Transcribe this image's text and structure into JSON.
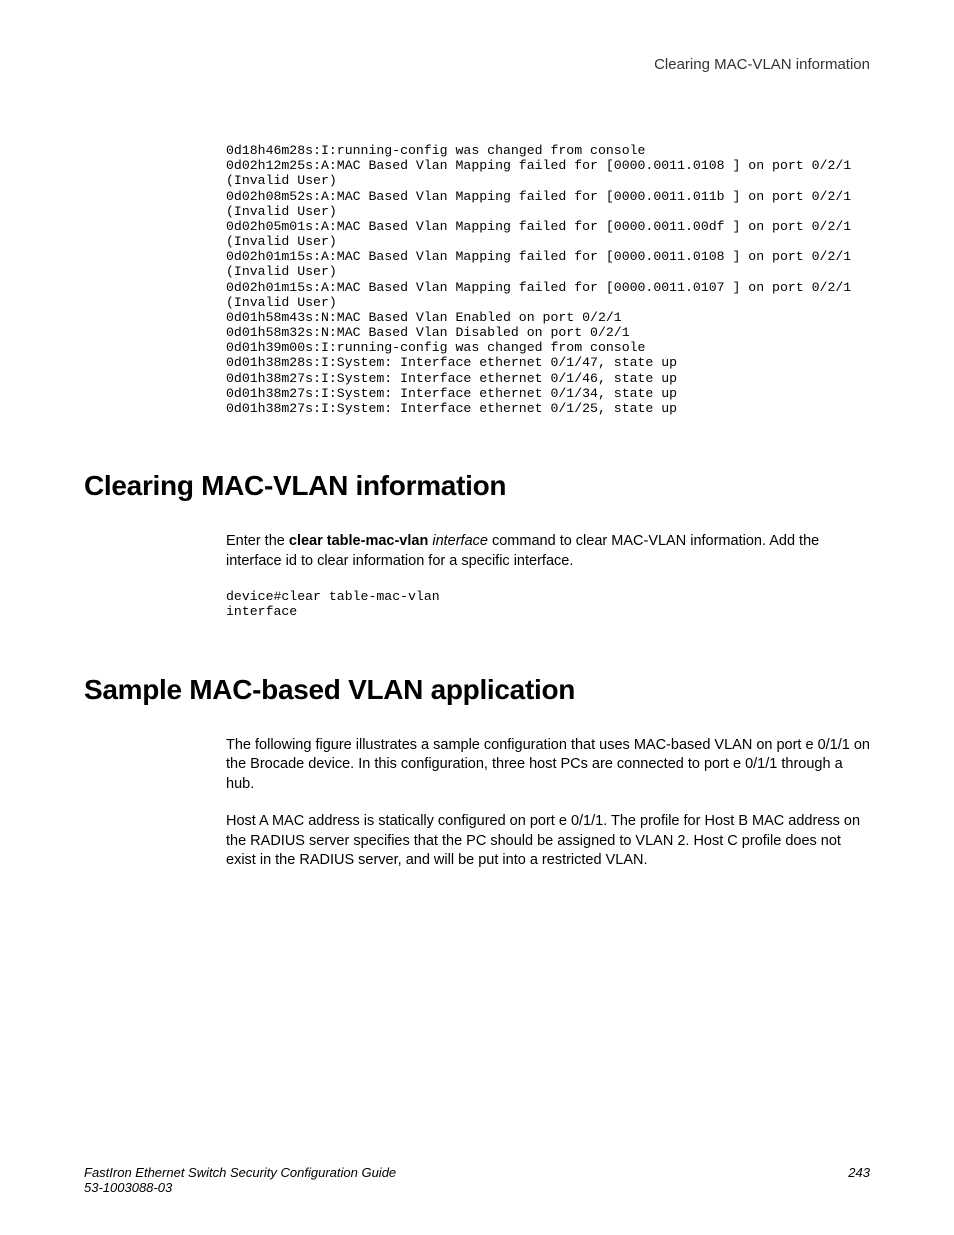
{
  "header": {
    "right": "Clearing MAC-VLAN information"
  },
  "logBlock": "0d18h46m28s:I:running-config was changed from console\n0d02h12m25s:A:MAC Based Vlan Mapping failed for [0000.0011.0108 ] on port 0/2/1\n(Invalid User)\n0d02h08m52s:A:MAC Based Vlan Mapping failed for [0000.0011.011b ] on port 0/2/1\n(Invalid User)\n0d02h05m01s:A:MAC Based Vlan Mapping failed for [0000.0011.00df ] on port 0/2/1\n(Invalid User)\n0d02h01m15s:A:MAC Based Vlan Mapping failed for [0000.0011.0108 ] on port 0/2/1\n(Invalid User)\n0d02h01m15s:A:MAC Based Vlan Mapping failed for [0000.0011.0107 ] on port 0/2/1\n(Invalid User)\n0d01h58m43s:N:MAC Based Vlan Enabled on port 0/2/1\n0d01h58m32s:N:MAC Based Vlan Disabled on port 0/2/1\n0d01h39m00s:I:running-config was changed from console\n0d01h38m28s:I:System: Interface ethernet 0/1/47, state up\n0d01h38m27s:I:System: Interface ethernet 0/1/46, state up\n0d01h38m27s:I:System: Interface ethernet 0/1/34, state up\n0d01h38m27s:I:System: Interface ethernet 0/1/25, state up",
  "section1": {
    "heading": "Clearing MAC-VLAN information",
    "para1_prefix": "Enter the ",
    "para1_cmd": "clear table-mac-vlan",
    "para1_param": " interface",
    "para1_suffix": " command to clear MAC-VLAN information. Add the interface id to clear information for a specific interface.",
    "code": "device#clear table-mac-vlan\ninterface"
  },
  "section2": {
    "heading": "Sample MAC-based VLAN application",
    "para1": "The following figure illustrates a sample configuration that uses MAC-based VLAN on port e 0/1/1 on the Brocade device. In this configuration, three host PCs are connected to port e 0/1/1 through a hub.",
    "para2": "Host A MAC address is statically configured on port e 0/1/1. The profile for Host B MAC address on the RADIUS server specifies that the PC should be assigned to VLAN 2. Host C profile does not exist in the RADIUS server, and will be put into a restricted VLAN."
  },
  "footer": {
    "title": "FastIron Ethernet Switch Security Configuration Guide",
    "docid": "53-1003088-03",
    "page": "243"
  }
}
